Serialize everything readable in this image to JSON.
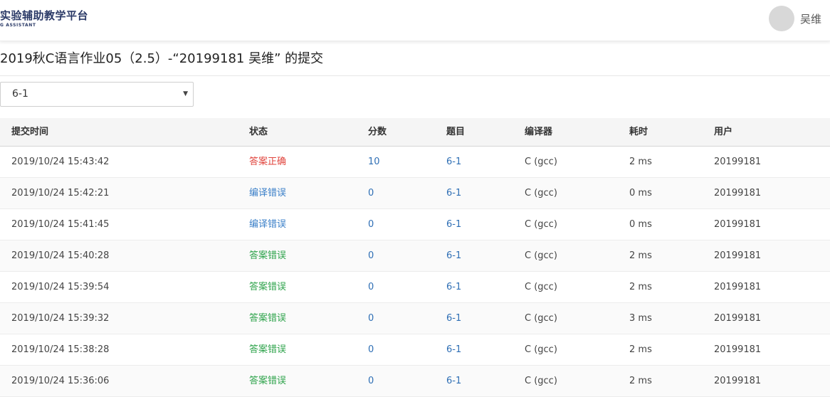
{
  "header": {
    "logo_title": "实验辅助教学平台",
    "logo_subtitle": "G ASSISTANT",
    "username": "吴维"
  },
  "page": {
    "title": "2019秋C语言作业05（2.5）-“20199181 吴维” 的提交"
  },
  "filter": {
    "selected": "6-1"
  },
  "colors": {
    "correct": "#e0443d",
    "compile_error": "#3a7fc8",
    "wrong": "#2ea34b",
    "link": "#2f6fb5"
  },
  "table": {
    "columns": [
      "提交时间",
      "状态",
      "分数",
      "题目",
      "编译器",
      "耗时",
      "用户"
    ],
    "rows": [
      {
        "time": "2019/10/24 15:43:42",
        "status": "答案正确",
        "status_type": "correct",
        "score": "10",
        "problem": "6-1",
        "compiler": "C (gcc)",
        "elapsed": "2 ms",
        "user": "20199181"
      },
      {
        "time": "2019/10/24 15:42:21",
        "status": "编译错误",
        "status_type": "compile",
        "score": "0",
        "problem": "6-1",
        "compiler": "C (gcc)",
        "elapsed": "0 ms",
        "user": "20199181"
      },
      {
        "time": "2019/10/24 15:41:45",
        "status": "编译错误",
        "status_type": "compile",
        "score": "0",
        "problem": "6-1",
        "compiler": "C (gcc)",
        "elapsed": "0 ms",
        "user": "20199181"
      },
      {
        "time": "2019/10/24 15:40:28",
        "status": "答案错误",
        "status_type": "wrong",
        "score": "0",
        "problem": "6-1",
        "compiler": "C (gcc)",
        "elapsed": "2 ms",
        "user": "20199181"
      },
      {
        "time": "2019/10/24 15:39:54",
        "status": "答案错误",
        "status_type": "wrong",
        "score": "0",
        "problem": "6-1",
        "compiler": "C (gcc)",
        "elapsed": "2 ms",
        "user": "20199181"
      },
      {
        "time": "2019/10/24 15:39:32",
        "status": "答案错误",
        "status_type": "wrong",
        "score": "0",
        "problem": "6-1",
        "compiler": "C (gcc)",
        "elapsed": "3 ms",
        "user": "20199181"
      },
      {
        "time": "2019/10/24 15:38:28",
        "status": "答案错误",
        "status_type": "wrong",
        "score": "0",
        "problem": "6-1",
        "compiler": "C (gcc)",
        "elapsed": "2 ms",
        "user": "20199181"
      },
      {
        "time": "2019/10/24 15:36:06",
        "status": "答案错误",
        "status_type": "wrong",
        "score": "0",
        "problem": "6-1",
        "compiler": "C (gcc)",
        "elapsed": "2 ms",
        "user": "20199181"
      }
    ]
  }
}
